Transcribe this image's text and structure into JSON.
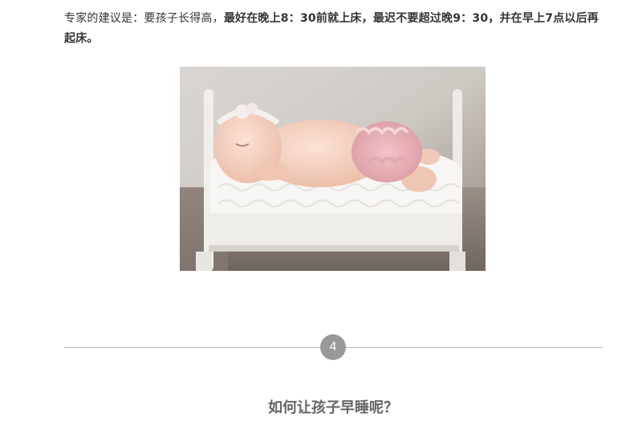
{
  "article": {
    "intro_plain": "专家的建议是：要孩子长得高，",
    "intro_bold": "最好在晚上8：30前就上床，最迟不要超过晚9：30，并在早上7点以后再起床。",
    "section_number": "4",
    "section_heading": "如何让孩子早睡呢？"
  },
  "colors": {
    "body_text": "#333333",
    "heading": "#666666",
    "divider": "#b3b3b3",
    "badge": "#999999"
  },
  "image": {
    "subject": "sleeping-baby-photo"
  }
}
